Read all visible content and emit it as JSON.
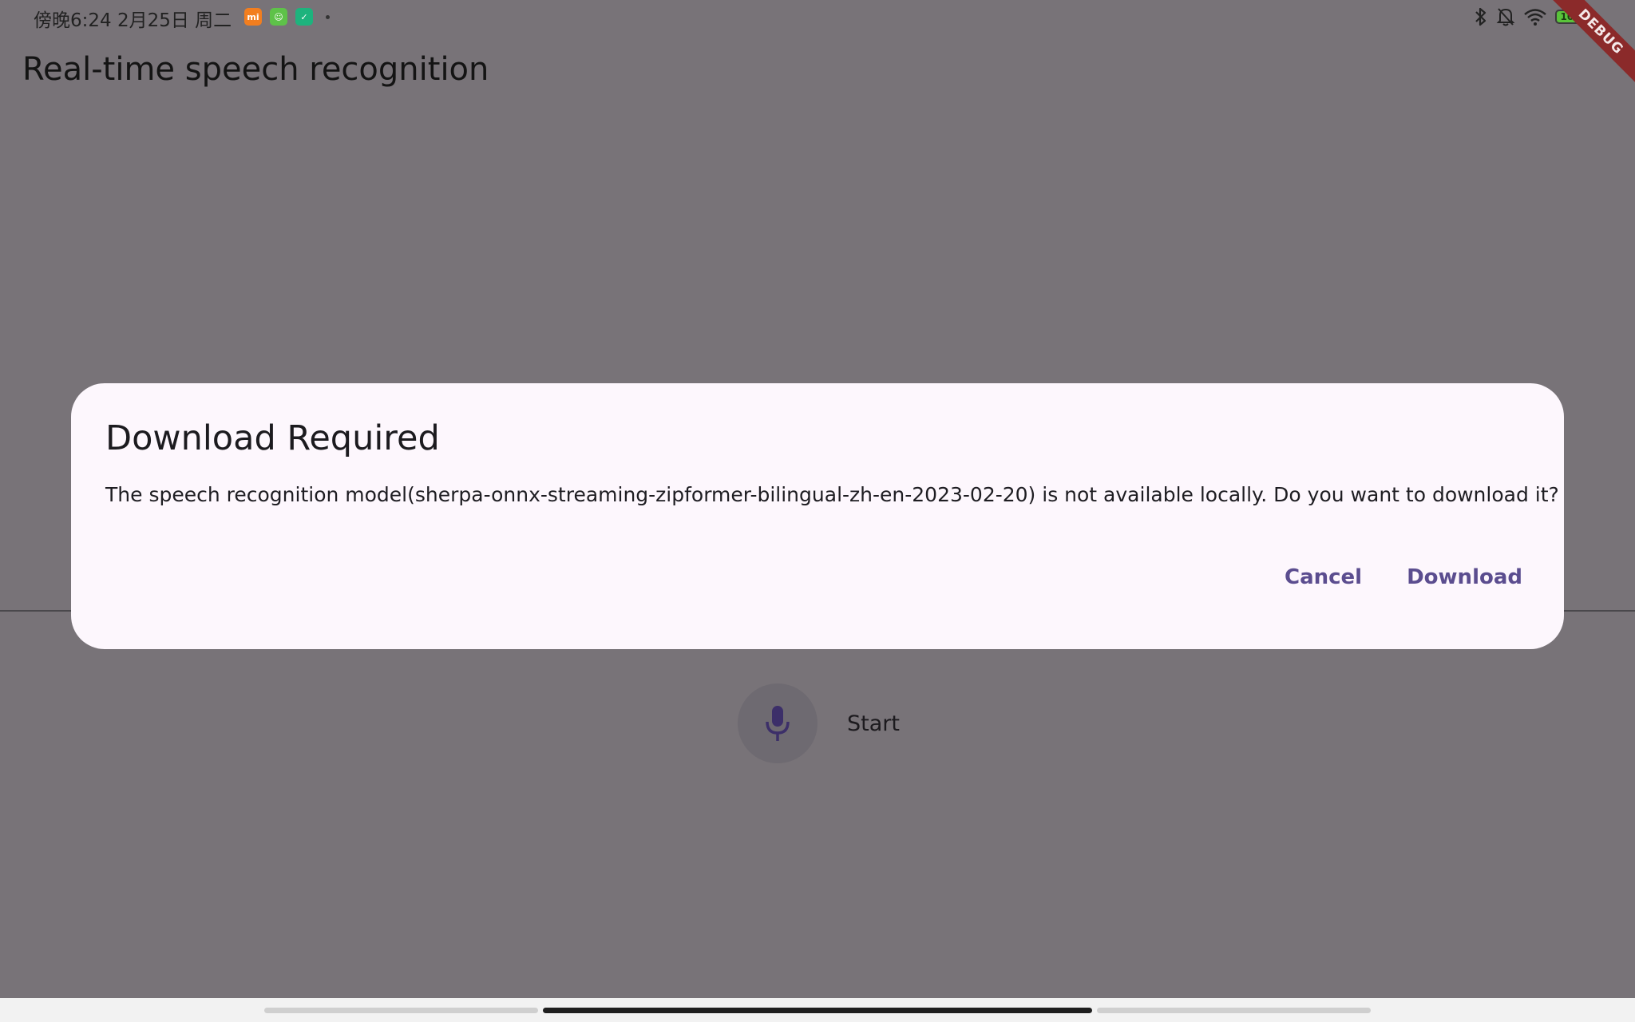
{
  "status_bar": {
    "time": "傍晚6:24 2月25日 周二",
    "app_icons": [
      {
        "name": "mi-icon",
        "label": "mi",
        "color": "#f27e1f"
      },
      {
        "name": "message-app-icon",
        "label": "☺",
        "color": "#5ec249"
      },
      {
        "name": "shield-app-icon",
        "label": "✓",
        "color": "#1db37d"
      }
    ],
    "battery_level": "100",
    "right_icons": [
      "bluetooth-icon",
      "bell-muted-icon",
      "wifi-icon",
      "battery-icon"
    ]
  },
  "debug_banner": "DEBUG",
  "app": {
    "title": "Real-time speech recognition",
    "mic_label": "Start"
  },
  "dialog": {
    "title": "Download Required",
    "message": "The speech recognition model(sherpa-onnx-streaming-zipformer-bilingual-zh-en-2023-02-20) is not available locally. Do you want to download it?",
    "cancel_label": "Cancel",
    "download_label": "Download"
  },
  "colors": {
    "scrim_background": "#787378",
    "dialog_surface": "#fdf7fd",
    "accent": "#5b4d8f",
    "mic_icon": "#3c2f69"
  }
}
